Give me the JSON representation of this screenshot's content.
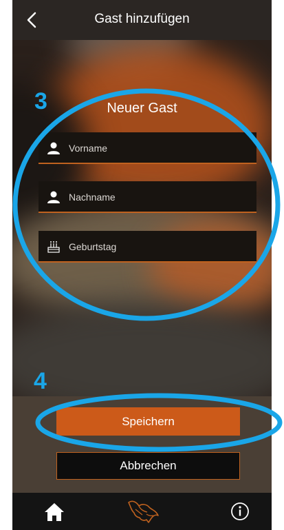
{
  "header": {
    "title": "Gast hinzufügen",
    "back_icon": "chevron-left-icon"
  },
  "form": {
    "title": "Neuer Gast",
    "fields": [
      {
        "label": "Vorname",
        "icon": "person-icon"
      },
      {
        "label": "Nachname",
        "icon": "person-icon"
      },
      {
        "label": "Geburtstag",
        "icon": "birthday-cake-icon"
      }
    ]
  },
  "actions": {
    "save_label": "Speichern",
    "cancel_label": "Abbrechen"
  },
  "tabbar": {
    "items": [
      "home-icon",
      "logo-icon",
      "info-icon"
    ]
  },
  "annotations": {
    "step_form": "3",
    "step_save": "4",
    "color": "#1aa6e8"
  },
  "colors": {
    "accent": "#cc5a19",
    "header_bg": "#2b2623",
    "tabbar_bg": "#141414"
  }
}
